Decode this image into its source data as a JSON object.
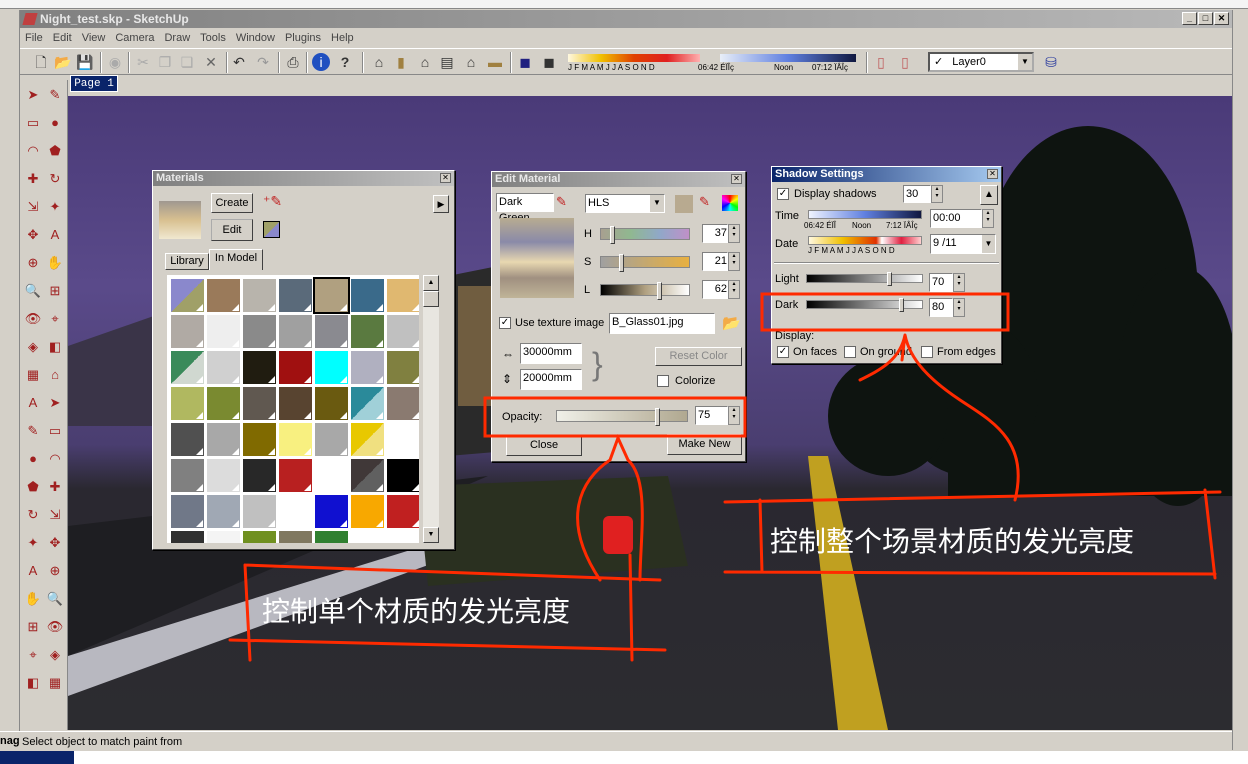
{
  "window": {
    "title": "Night_test.skp - SketchUp"
  },
  "menu": [
    "File",
    "Edit",
    "View",
    "Camera",
    "Draw",
    "Tools",
    "Window",
    "Plugins",
    "Help"
  ],
  "toolbar": {
    "months": "J  F  M A M J  J  A  S  O  N  D",
    "time_start": "06:42 ÉÏÎç",
    "time_noon": "Noon",
    "time_end": "07:12 ÏÂÎç",
    "layer": "Layer0",
    "layer_check": "✓"
  },
  "page_tab": "Page 1",
  "status": {
    "text": "Select object to match paint from",
    "left_fragment": "nag"
  },
  "materials": {
    "title": "Materials",
    "create": "Create",
    "edit": "Edit",
    "tabs": [
      "Library",
      "In Model"
    ],
    "active_tab": "In Model",
    "swatches": [
      [
        "split:#8a88cc:#a0a068",
        "#9a7a5a",
        "#b8b4ac",
        "#5a6a7a",
        "#b0a080",
        "#3a6a8a",
        "#e0b870"
      ],
      [
        "#b0aaa4",
        "#eeeeee",
        "#8a8a8a",
        "#a0a0a0",
        "#8a8a90",
        "#5a7a40",
        "#c0c0c0"
      ],
      [
        "split:#3a8a5a:#d0d8d0",
        "#d0d0d0",
        "#201c10",
        "#a01010",
        "#00ffff",
        "#b0b0c0",
        "#808040"
      ],
      [
        "#b0b860",
        "#7a8a30",
        "#605850",
        "#584430",
        "#6a5a10",
        "split:#2a8a9a:#a0d0d8",
        "#8a7a70"
      ],
      [
        "#505050",
        "#a8a8a8",
        "#806a00",
        "#f8f080",
        "#a8a8a8",
        "split:#e8c800:#f0e080",
        "#ffffff"
      ],
      [
        "#808080",
        "#dcdcdc",
        "#282828",
        "#b82020",
        "#ffffff",
        "split:#403838:#606060",
        "#000000"
      ],
      [
        "#707888",
        "#a0a8b4",
        "#c0c0c0",
        "#ffffff",
        "#1010d0",
        "#f8a800",
        "#c02020"
      ],
      [
        "#303030",
        "#f4f4f4",
        "#709020",
        "#807860",
        "#308030",
        "#ffffff",
        "#ffffff"
      ]
    ]
  },
  "edit_material": {
    "title": "Edit Material",
    "name": "Dark Green",
    "color_model": "HLS",
    "h_label": "H",
    "s_label": "S",
    "l_label": "L",
    "h": "37",
    "s": "21",
    "l": "62",
    "use_texture_label": "Use texture image",
    "texture_file": "B_Glass01.jpg",
    "width": "30000mm",
    "height": "20000mm",
    "reset_color": "Reset Color",
    "colorize": "Colorize",
    "opacity_label": "Opacity:",
    "opacity": "75",
    "close": "Close",
    "make_new": "Make New"
  },
  "shadow": {
    "title": "Shadow Settings",
    "display_shadows": "Display shadows",
    "utc": "30",
    "time_label": "Time",
    "time_value": "00:00",
    "time_start": "06:42 ÉÏÎ",
    "time_noon": "Noon",
    "time_end": "7:12 ÏÂÎç",
    "date_label": "Date",
    "date_value": "9 /11",
    "months": "J  F M A M J  J  A S  O  N  D",
    "light_label": "Light",
    "light": "70",
    "dark_label": "Dark",
    "dark": "80",
    "display_label": "Display:",
    "on_faces": "On faces",
    "on_ground": "On ground",
    "from_edges": "From edges"
  },
  "annotations": {
    "single": "控制单个材质的发光亮度",
    "scene": "控制整个场景材质的发光亮度",
    "color": "#ff2a00"
  }
}
